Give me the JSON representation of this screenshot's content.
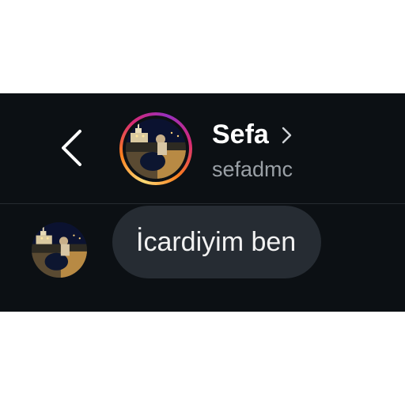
{
  "header": {
    "display_name": "Sefa",
    "username": "sefadmc",
    "back_icon": "chevron-left-icon",
    "profile_chevron_icon": "chevron-right-icon",
    "story_ring_colors": [
      "#feda75",
      "#fa7e1e",
      "#d62976",
      "#962fbf"
    ]
  },
  "messages": [
    {
      "text": "İcardiyim ben",
      "sender": "sefadmc"
    }
  ],
  "colors": {
    "background": "#0c1014",
    "bubble": "#262c33",
    "username": "#9aa0a6",
    "text": "#ffffff"
  }
}
